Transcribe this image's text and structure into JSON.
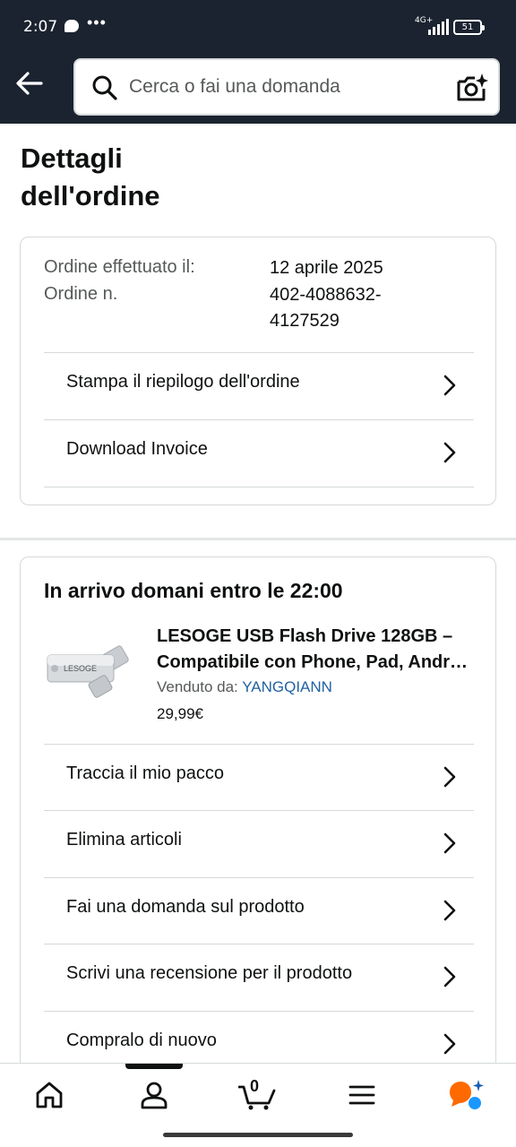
{
  "status_bar": {
    "time": "2:07",
    "network": "4G+",
    "battery": "51"
  },
  "header": {
    "search_placeholder": "Cerca o fai una domanda"
  },
  "page": {
    "title_line1": "Dettagli",
    "title_line2": "dell'ordine"
  },
  "order_summary": {
    "date_label": "Ordine effettuato il:",
    "date_value": "12 aprile 2025",
    "number_label": "Ordine n.",
    "number_value_line1": "402-4088632-",
    "number_value_line2": "4127529",
    "actions": [
      "Stampa il riepilogo dell'ordine",
      "Download Invoice"
    ]
  },
  "shipment": {
    "delivery_status": "In arrivo domani entro le 22:00",
    "product": {
      "name_line1": "LESOGE USB Flash Drive 128GB –",
      "name_line2": "Compatibile con Phone, Pad, Andr…",
      "sold_by_label": "Venduto da:",
      "seller": "YANGQIANN",
      "price": "29,99€",
      "brand_mark": "LESOGE"
    },
    "actions": [
      "Traccia il mio pacco",
      "Elimina articoli",
      "Fai una domanda sul prodotto",
      "Scrivi una recensione per il prodotto",
      "Compralo di nuovo"
    ]
  },
  "bottom_nav": {
    "items": [
      "home-icon",
      "account-icon",
      "cart-icon",
      "menu-icon",
      "rufus-icon"
    ],
    "cart_count": "0",
    "active_index": 1
  }
}
